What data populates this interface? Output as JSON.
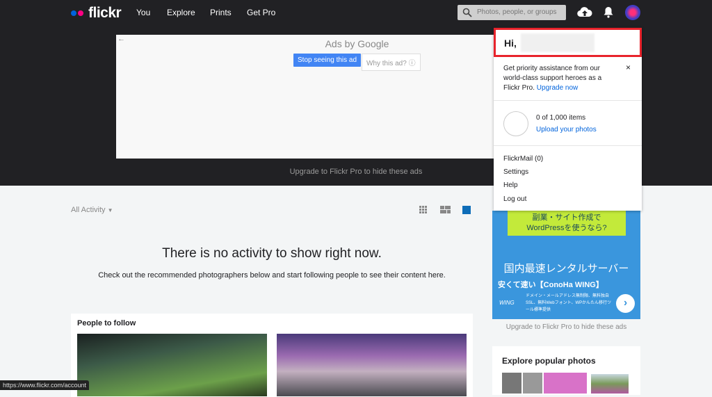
{
  "nav": {
    "brand": "flickr",
    "items": [
      "You",
      "Explore",
      "Prints",
      "Get Pro"
    ],
    "search_placeholder": "Photos, people, or groups"
  },
  "top_ad": {
    "ads_by": "Ads by Google",
    "stop": "Stop seeing this ad",
    "why": "Why this ad? ⓘ",
    "upgrade": "Upgrade to Flickr Pro to hide these ads"
  },
  "menu": {
    "greeting": "Hi,",
    "promo_text": "Get priority assistance from our world-class support heroes as a Flickr Pro.",
    "promo_link": "Upgrade now",
    "items_count": "0 of 1,000 items",
    "upload": "Upload your photos",
    "links": [
      "FlickrMail (0)",
      "Settings",
      "Help",
      "Log out"
    ]
  },
  "feed": {
    "filter": "All Activity",
    "empty_title": "There is no activity to show right now.",
    "empty_sub": "Check out the recommended photographers below and start following people to see their content here.",
    "people_title": "People to follow"
  },
  "side_ad": {
    "line1": "副業・サイト作成で",
    "line2": "WordPressを使うなら?",
    "headline": "国内最速レンタルサーバー",
    "sub": "安くて速い【ConoHa WING】",
    "small": "ドメイン・メールアドレス無制限、無料独自SSL、無料Webフォント、WPかんたん移行ツール標準提供",
    "logo": "WING",
    "upgrade": "Upgrade to Flickr Pro to hide these ads"
  },
  "explore": {
    "title": "Explore popular photos"
  },
  "status_url": "https://www.flickr.com/account",
  "colors": {
    "blue_dot": "#0063dc",
    "pink_dot": "#ff0084",
    "highlight": "#e8232b",
    "link": "#0063dc"
  }
}
